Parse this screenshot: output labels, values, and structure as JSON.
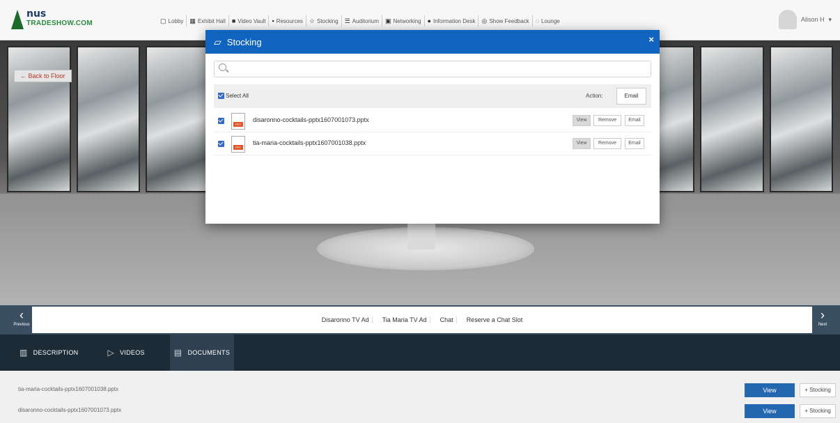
{
  "brand": {
    "name": "nus",
    "sub": "TRADESHOW.COM"
  },
  "nav": {
    "items": [
      {
        "icon": "▢",
        "label": "Lobby"
      },
      {
        "icon": "▦",
        "label": "Exhibit Hall"
      },
      {
        "icon": "■",
        "label": "Video Vault"
      },
      {
        "icon": "▪",
        "label": "Resources"
      },
      {
        "icon": "☆",
        "label": "Stocking"
      },
      {
        "icon": "☰",
        "label": "Auditorium"
      },
      {
        "icon": "▣",
        "label": "Networking"
      },
      {
        "icon": "●",
        "label": "Information Desk"
      },
      {
        "icon": "◎",
        "label": "Show Feedback"
      },
      {
        "icon": "◌",
        "label": "Lounge"
      }
    ]
  },
  "user": {
    "name": "Alison H",
    "caret": "▾"
  },
  "stage": {
    "back_label": "← Back to Floor"
  },
  "modal": {
    "title": "Stocking",
    "close": "×",
    "search_placeholder": "",
    "select_all": "Select All",
    "action_label": "Action:",
    "action_email": "Email",
    "files": [
      {
        "name": "disaronno-cocktails-pptx1607001073.pptx",
        "badge": "PPT",
        "view": "View",
        "remove": "Remove",
        "email": "Email"
      },
      {
        "name": "tia-maria-cocktails-pptx1607001038.pptx",
        "badge": "PPT",
        "view": "View",
        "remove": "Remove",
        "email": "Email"
      }
    ]
  },
  "carousel": {
    "prev_arrow": "‹",
    "prev_label": "Previous",
    "next_arrow": "›",
    "next_label": "Next",
    "items": [
      "Disaronno TV Ad",
      "Tia Maria TV Ad",
      "Chat",
      "Reserve a Chat Slot"
    ]
  },
  "tabs": [
    {
      "icon": "▥",
      "label": "DESCRIPTION"
    },
    {
      "icon": "▷",
      "label": "VIDEOS"
    },
    {
      "icon": "▤",
      "label": "DOCUMENTS"
    }
  ],
  "documents": [
    {
      "name": "tia-maria-cocktails-pptx1607001038.pptx",
      "view": "View",
      "stock": "+ Stocking"
    },
    {
      "name": "disaronno-cocktails-pptx1607001073.pptx",
      "view": "View",
      "stock": "+ Stocking"
    }
  ],
  "colors": {
    "modal_header": "#1163c0",
    "tab_bar": "#1d2b36",
    "view_button": "#2367b0",
    "back_text": "#c0392b"
  }
}
